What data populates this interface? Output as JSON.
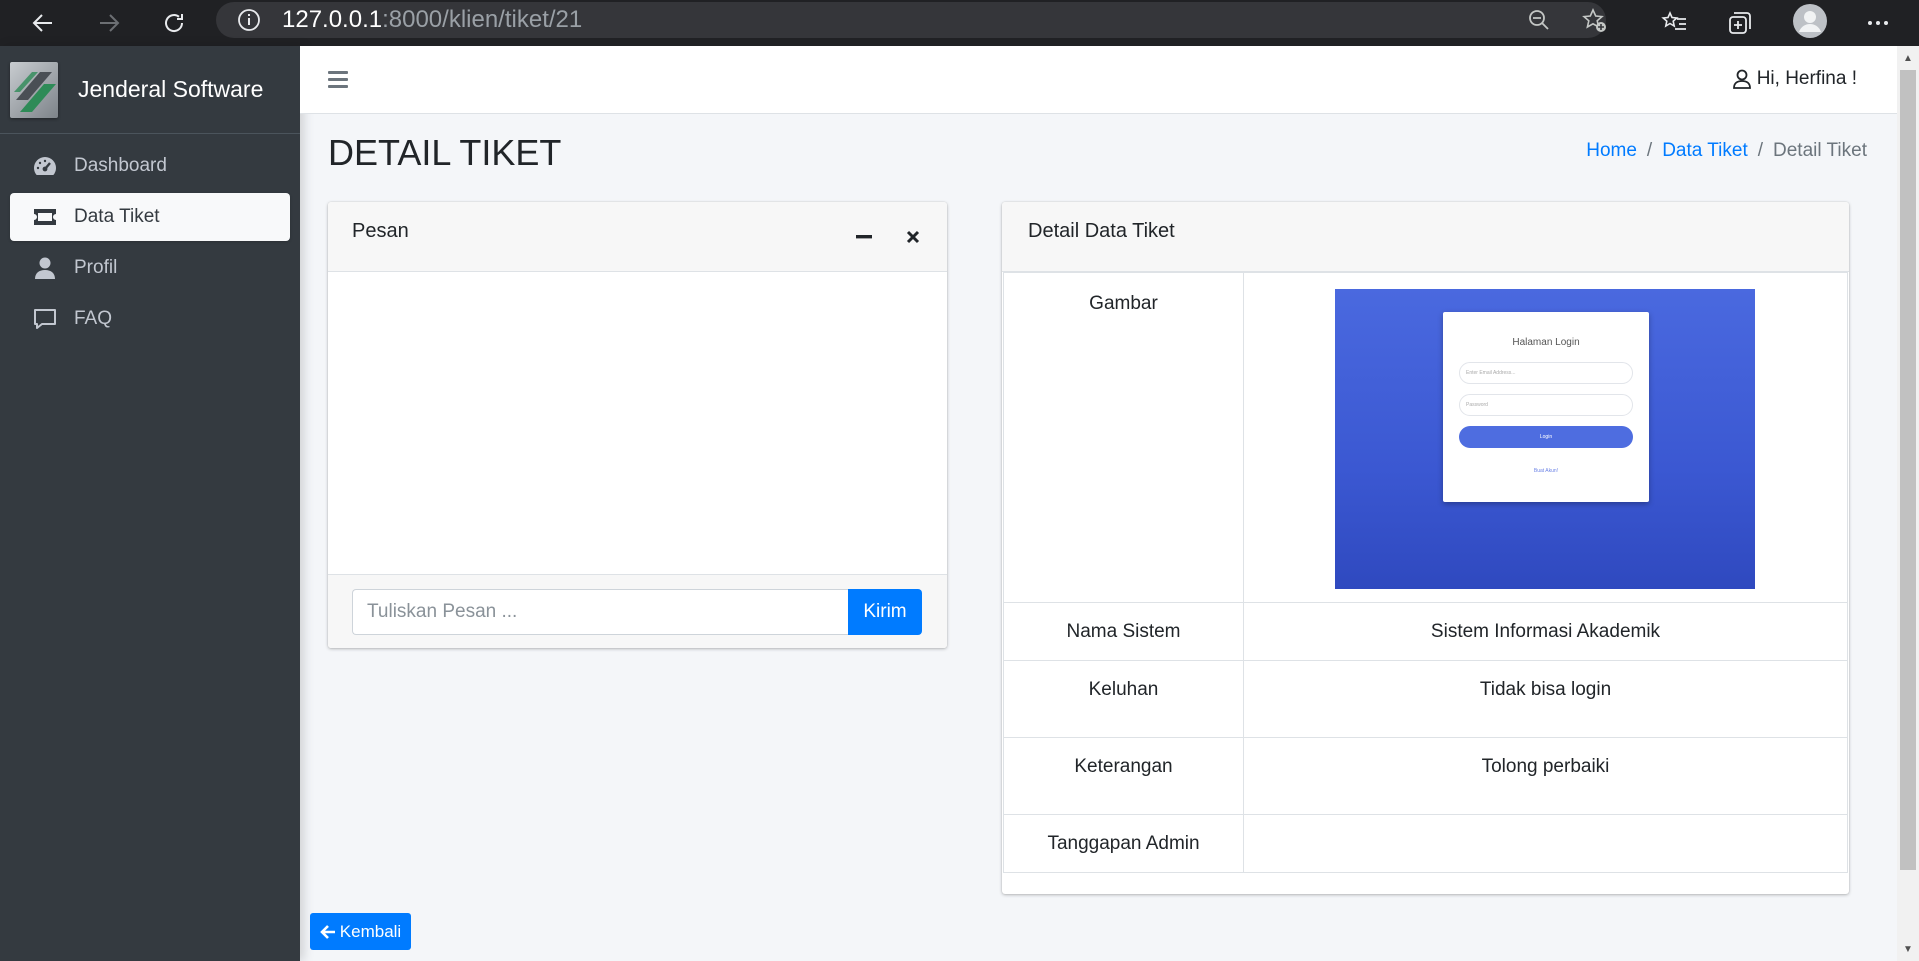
{
  "browser": {
    "url_host": "127.0.0.1",
    "url_path": ":8000/klien/tiket/21"
  },
  "sidebar": {
    "brand": "Jenderal Software",
    "items": [
      {
        "label": "Dashboard",
        "icon": "tachometer-icon",
        "active": false
      },
      {
        "label": "Data Tiket",
        "icon": "ticket-icon",
        "active": true
      },
      {
        "label": "Profil",
        "icon": "user-icon",
        "active": false
      },
      {
        "label": "FAQ",
        "icon": "comment-icon",
        "active": false
      }
    ]
  },
  "topbar": {
    "greeting": "Hi, Herfina !"
  },
  "page": {
    "title": "DETAIL TIKET"
  },
  "breadcrumb": {
    "home": "Home",
    "separator": "/",
    "data_tiket": "Data Tiket",
    "current": "Detail Tiket"
  },
  "chat": {
    "title": "Pesan",
    "input_placeholder": "Tuliskan Pesan ...",
    "send_label": "Kirim"
  },
  "detail": {
    "title": "Detail Data Tiket",
    "rows": [
      {
        "label": "Gambar",
        "value": ""
      },
      {
        "label": "Nama Sistem",
        "value": "Sistem Informasi Akademik"
      },
      {
        "label": "Keluhan",
        "value": "Tidak bisa login"
      },
      {
        "label": "Keterangan",
        "value": "Tolong perbaiki"
      },
      {
        "label": "Tanggapan Admin",
        "value": ""
      }
    ],
    "screenshot": {
      "title": "Halaman Login",
      "email_placeholder": "Enter Email Address...",
      "password_placeholder": "Password",
      "button": "Login",
      "link": "Buat Akun!"
    }
  },
  "back_button": "Kembali",
  "colors": {
    "primary": "#007bff",
    "sidebar_bg": "#343a40",
    "content_bg": "#f4f6f9"
  }
}
